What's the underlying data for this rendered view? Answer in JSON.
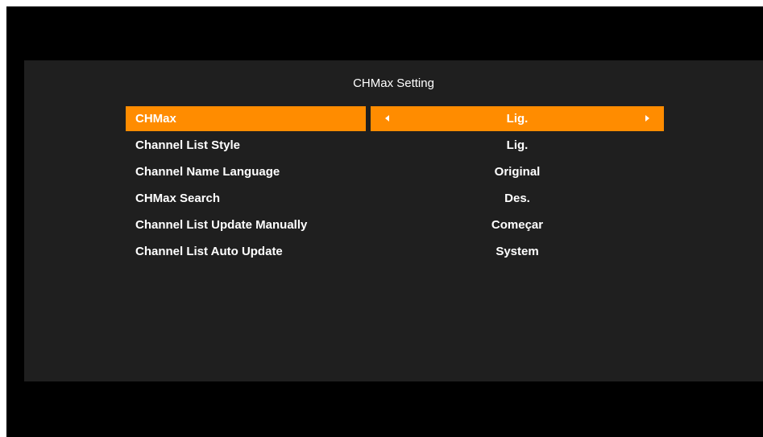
{
  "title": "CHMax Setting",
  "accent_color": "#ff8c00",
  "items": [
    {
      "label": "CHMax",
      "value": "Lig.",
      "selected": true
    },
    {
      "label": "Channel List Style",
      "value": "Lig.",
      "selected": false
    },
    {
      "label": "Channel Name Language",
      "value": "Original",
      "selected": false
    },
    {
      "label": "CHMax Search",
      "value": "Des.",
      "selected": false
    },
    {
      "label": "Channel List Update Manually",
      "value": "Começar",
      "selected": false
    },
    {
      "label": "Channel List Auto Update",
      "value": "System",
      "selected": false
    }
  ],
  "icons": {
    "left": "left-arrow-icon",
    "right": "right-arrow-icon"
  }
}
